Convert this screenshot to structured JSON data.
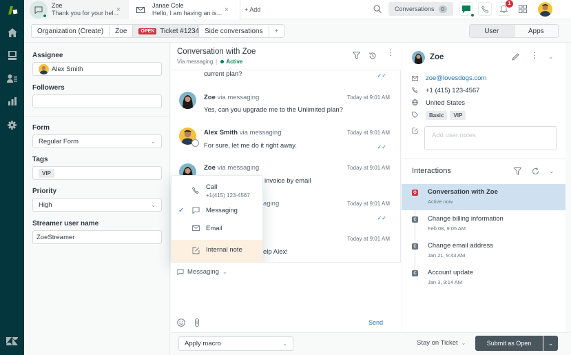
{
  "colors": {
    "nav_bg": "#03363d",
    "brand_green": "#78a300",
    "open_badge": "#cc3340",
    "link_blue": "#1f73b7",
    "active_green": "#038153",
    "highlight_blue": "#cfe1f0",
    "internal_note_bg": "#fdf0e1",
    "submit_bg": "#4a565e"
  },
  "leftnav": {
    "items": [
      {
        "icon": "home-icon"
      },
      {
        "icon": "views-icon"
      },
      {
        "icon": "customers-icon"
      },
      {
        "icon": "reporting-icon"
      },
      {
        "icon": "admin-gear-icon"
      }
    ]
  },
  "topbar": {
    "tabs": [
      {
        "title": "Zoe",
        "subtitle": "Thank you for your hel...",
        "icon": "chat-icon",
        "close": "×"
      },
      {
        "title": "Janae Cole",
        "subtitle": "Hello, I am having an is...",
        "icon": "mail-icon",
        "close": "×"
      }
    ],
    "add_label": "+ Add",
    "conversations_label": "Conversations",
    "conversations_count": "0",
    "notification_count": "1"
  },
  "subbar": {
    "breadcrumbs": [
      "Organization (Create)",
      "Zoe"
    ],
    "ticket_status": "OPEN",
    "ticket_label": "Ticket #1234",
    "side_conversations_label": "Side conversations",
    "side_add": "+",
    "segments": [
      "User",
      "Apps"
    ]
  },
  "properties": {
    "assignee_label": "Assignee",
    "assignee_value": "Alex Smith",
    "followers_label": "Followers",
    "followers_value": "",
    "form_label": "Form",
    "form_value": "Regular Form",
    "tags_label": "Tags",
    "tags": [
      "VIP"
    ],
    "priority_label": "Priority",
    "priority_value": "High",
    "streamer_label": "Streamer user name",
    "streamer_value": "ZoeStreamer"
  },
  "conversation": {
    "title": "Conversation with Zoe",
    "via": "Via messaging",
    "status": "Active",
    "messages": [
      {
        "author": "",
        "via": "",
        "time": "",
        "text": "current plan?",
        "read": true
      },
      {
        "author": "Zoe",
        "via": "via messaging",
        "time": "Today at 9:01 AM",
        "text": "Yes, can you upgrade me to the Unlimited plan?",
        "read": false
      },
      {
        "author": "Alex Smith",
        "via": "via messaging",
        "time": "Today at 9:01 AM",
        "text": "For sure, let me do it right away.",
        "read": true
      },
      {
        "author": "Zoe",
        "via": "via messaging",
        "time": "Today at 9:01 AM",
        "text": "invoice by email",
        "read": false
      },
      {
        "author": "",
        "via": "aging",
        "time": "Today at 9:01 AM",
        "text": "",
        "read": true
      },
      {
        "author": "",
        "via": "",
        "time": "Today at 9:01 AM",
        "text": "elp Alex!",
        "read": false
      }
    ]
  },
  "channel_menu": {
    "items": [
      {
        "label": "Call",
        "sub": "+1(415) 123-4567",
        "icon": "phone-icon",
        "checked": false
      },
      {
        "label": "Messaging",
        "sub": "",
        "icon": "chat-icon",
        "checked": true
      },
      {
        "label": "Email",
        "sub": "",
        "icon": "mail-icon",
        "checked": false
      },
      {
        "label": "Internal note",
        "sub": "",
        "icon": "note-icon",
        "checked": false,
        "highlighted": true
      }
    ]
  },
  "composer": {
    "channel_label": "Messaging",
    "send_label": "Send"
  },
  "footer": {
    "macro_label": "Apply macro",
    "stay_label": "Stay on Ticket",
    "submit_label": "Submit as Open"
  },
  "user": {
    "name": "Zoe",
    "email": "zoe@lovesdogs.com",
    "phone": "+1 (415) 123-4567",
    "country": "United States",
    "tags": [
      "Basic",
      "VIP"
    ],
    "notes_placeholder": "Add user notes"
  },
  "interactions": {
    "title": "Interactions",
    "items": [
      {
        "badge": "O",
        "title": "Conversation with Zoe",
        "time": "Active now",
        "active": true
      },
      {
        "badge": "C",
        "title": "Change billing information",
        "time": "Feb 08, 9:05 AM",
        "active": false
      },
      {
        "badge": "C",
        "title": "Change email address",
        "time": "Jan 21, 9:43 AM",
        "active": false
      },
      {
        "badge": "C",
        "title": "Account update",
        "time": "Jan 3, 9:14 AM",
        "active": false
      }
    ]
  }
}
